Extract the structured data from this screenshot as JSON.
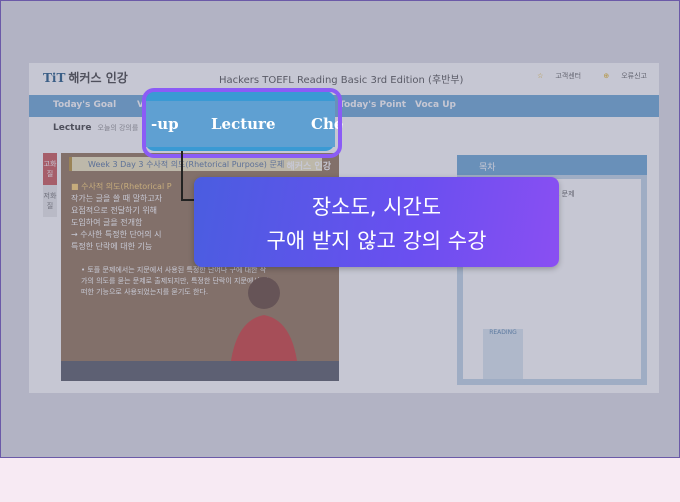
{
  "app": {
    "logo_text": "해커스 인강",
    "logo_mark": "TiT",
    "title": "Hackers TOEFL Reading Basic 3rd Edition (후반부)",
    "top_links": [
      "고객센터",
      "오류신고"
    ]
  },
  "nav": {
    "items": [
      "Today's Goal",
      "V",
      "-up",
      "Lecture",
      "Che",
      "Today's Point",
      "Voca Up"
    ]
  },
  "breadcrumb": {
    "label": "Lecture",
    "sub": "오늘의 강의를"
  },
  "side_tabs": [
    "고화질",
    "저화질"
  ],
  "video": {
    "slide_title": "Week 3 Day 3 수사적 의도(Rhetorical Purpose) 문제",
    "logo": "해커스 인강",
    "heading": "■ 수사적 의도(Rhetorical P",
    "lines": [
      "작가는 글을 쓸 때 말하고자",
      "요점적으로 전달하기 위해",
      "도입하여 글을 전개함",
      "→ 수사한 특정한 단어의 시",
      "특정한 단락에 대한 기능"
    ],
    "bullet": "• 토플 문제에서는 지문에서 사용된 특정한 단어나 구에 대한 작가의 의도를 묻는 문제로 출제되지만, 특정한 단락이 지문에서 어떠한 기능으로 사용되었는지를 묻기도 한다."
  },
  "right_panel": {
    "header": "목차",
    "item": "도 문제",
    "book": "READING"
  },
  "callout": {
    "line1": "장소도, 시간도",
    "line2": "구애 받지 않고 강의 수강"
  },
  "colors": {
    "nav": "#5fa0d2",
    "highlight_border": "#8b5cf6",
    "callout_start": "#4a5de0",
    "callout_end": "#8a4ff2"
  }
}
